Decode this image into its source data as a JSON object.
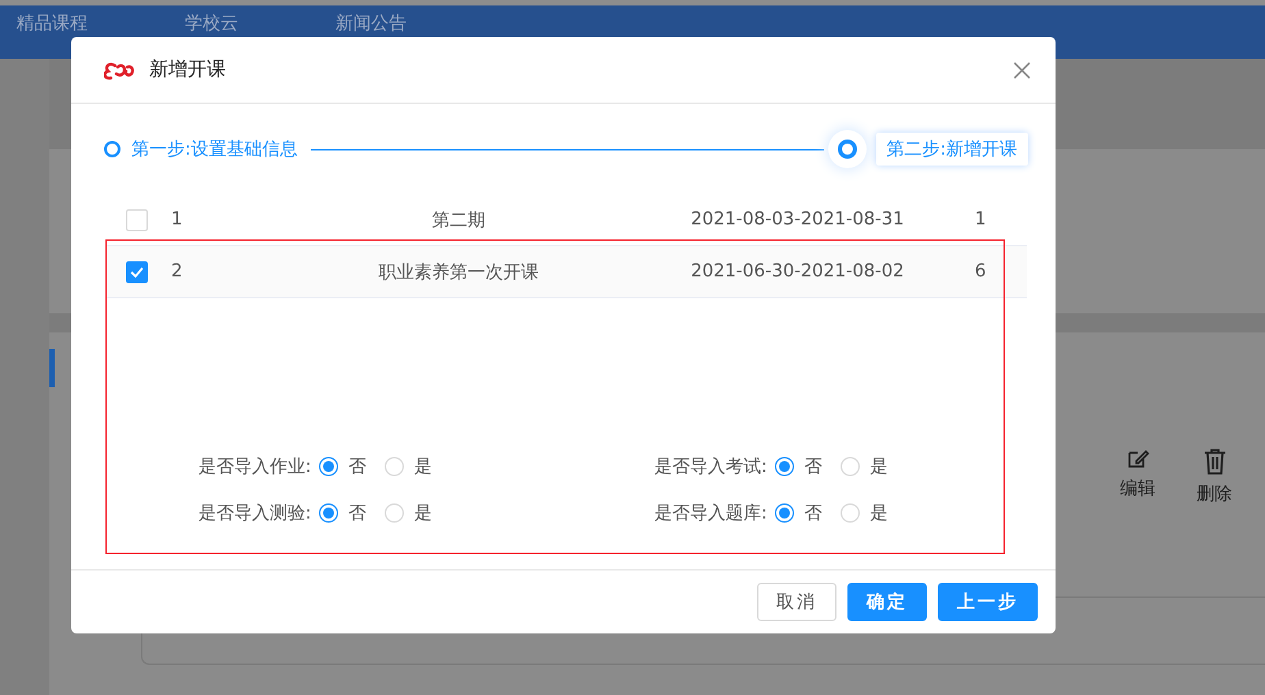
{
  "nav": {
    "items": [
      "精品课程",
      "学校云",
      "新闻公告"
    ]
  },
  "background": {
    "actions": [
      {
        "kind": "edit",
        "label": "编辑"
      },
      {
        "kind": "delete",
        "label": "删除"
      }
    ]
  },
  "dialog": {
    "title": "新增开课",
    "steps": [
      {
        "label": "第一步:设置基础信息",
        "selected": false
      },
      {
        "label": "第二步:新增开课",
        "selected": true
      }
    ],
    "rows": [
      {
        "checked": false,
        "cells": [
          "1",
          "第二期",
          "2021-08-03-2021-08-31",
          "1"
        ]
      },
      {
        "checked": true,
        "cells": [
          "2",
          "职业素养第一次开课",
          "2021-06-30-2021-08-02",
          "6"
        ]
      }
    ],
    "options": [
      {
        "label": "是否导入作业:",
        "choices": [
          {
            "label": "否",
            "selected": true
          },
          {
            "label": "是",
            "selected": false
          }
        ]
      },
      {
        "label": "是否导入考试:",
        "choices": [
          {
            "label": "否",
            "selected": true
          },
          {
            "label": "是",
            "selected": false
          }
        ]
      },
      {
        "label": "是否导入测验:",
        "choices": [
          {
            "label": "否",
            "selected": true
          },
          {
            "label": "是",
            "selected": false
          }
        ]
      },
      {
        "label": "是否导入题库:",
        "choices": [
          {
            "label": "否",
            "selected": true
          },
          {
            "label": "是",
            "selected": false
          }
        ]
      }
    ],
    "buttons": [
      {
        "label": "取消",
        "kind": "default"
      },
      {
        "label": "确定",
        "kind": "primary"
      },
      {
        "label": "上一步",
        "kind": "primary"
      }
    ]
  }
}
